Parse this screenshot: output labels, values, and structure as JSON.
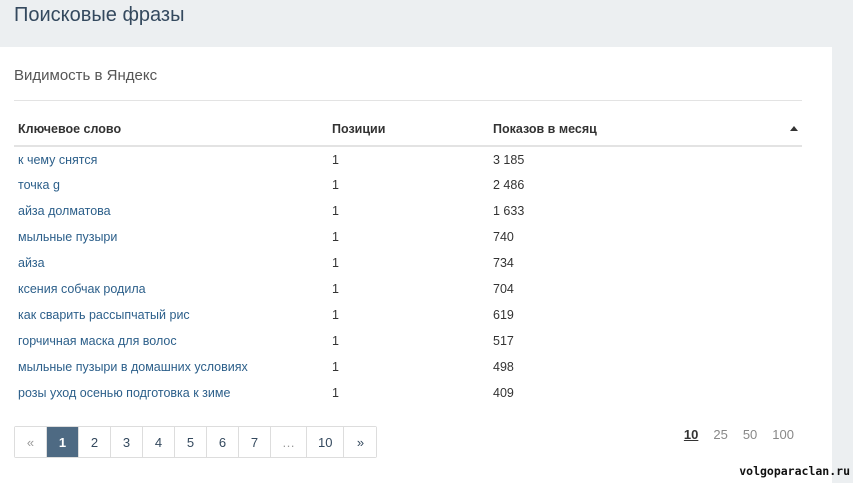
{
  "page": {
    "title": "Поисковые фразы"
  },
  "card": {
    "title": "Видимость в Яндекс"
  },
  "table": {
    "headers": [
      "Ключевое слово",
      "Позиции",
      "Показов в месяц"
    ],
    "sort": {
      "column": "Показов в месяц",
      "direction": "ascending-indicator"
    },
    "rows": [
      {
        "keyword": "к чему снятся",
        "position": "1",
        "views": "3 185"
      },
      {
        "keyword": "точка g",
        "position": "1",
        "views": "2 486"
      },
      {
        "keyword": "айза долматова",
        "position": "1",
        "views": "1 633"
      },
      {
        "keyword": "мыльные пузыри",
        "position": "1",
        "views": "740"
      },
      {
        "keyword": "айза",
        "position": "1",
        "views": "734"
      },
      {
        "keyword": "ксения собчак родила",
        "position": "1",
        "views": "704"
      },
      {
        "keyword": "как сварить рассыпчатый рис",
        "position": "1",
        "views": "619"
      },
      {
        "keyword": "горчичная маска для волос",
        "position": "1",
        "views": "517"
      },
      {
        "keyword": "мыльные пузыри в домашних условиях",
        "position": "1",
        "views": "498"
      },
      {
        "keyword": "розы уход осенью подготовка к зиме",
        "position": "1",
        "views": "409"
      }
    ]
  },
  "pagination": {
    "prev": "«",
    "pages": [
      "1",
      "2",
      "3",
      "4",
      "5",
      "6",
      "7",
      "…",
      "10"
    ],
    "next": "»",
    "current": "1"
  },
  "page_size": {
    "options": [
      "10",
      "25",
      "50",
      "100"
    ],
    "selected": "10"
  },
  "watermark": "volgoparaclan.ru",
  "colors": {
    "background": "#eceff1",
    "card": "#ffffff",
    "title": "#34495e",
    "link": "#2c5f8a",
    "active_page": "#4e6a83"
  }
}
